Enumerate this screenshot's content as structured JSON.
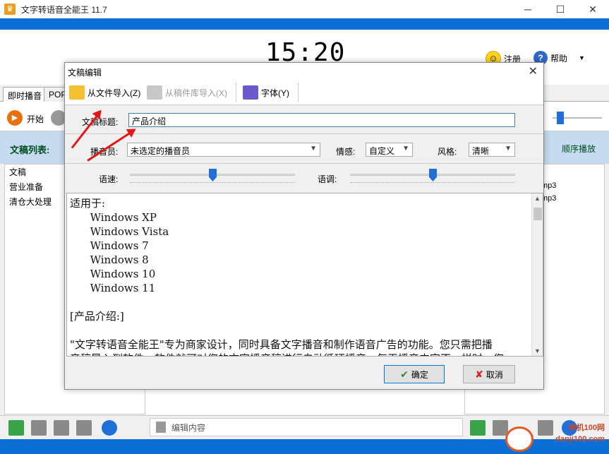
{
  "app": {
    "title": "文字转语音全能王 11.7",
    "clock": "15:20",
    "register": "注册",
    "help": "帮助"
  },
  "tabs": [
    "即时播音",
    "POP"
  ],
  "controls": {
    "start": "开始"
  },
  "list": {
    "title": "文稿列表:",
    "sequence": "顺序播放",
    "items": [
      "文稿",
      "营业准备",
      "清仓大处理"
    ],
    "right_items": [
      "mp3",
      "mp3"
    ]
  },
  "bottom": {
    "edit_placeholder": "编辑内容"
  },
  "watermark": {
    "line1": "单机100网",
    "line2": "danji100.com"
  },
  "dialog": {
    "title": "文稿编辑",
    "import_file": "从文件导入(Z)",
    "import_lib": "从稿件库导入(X)",
    "font": "字体(Y)",
    "title_label": "文稿标题:",
    "title_value": "产品介绍",
    "announcer_label": "播音员:",
    "announcer_value": "未选定的播音员",
    "emotion_label": "情感:",
    "emotion_value": "自定义",
    "style_label": "风格:",
    "style_value": "清晰",
    "speed_label": "语速:",
    "pitch_label": "语调:",
    "speed_value": 0.5,
    "pitch_value": 0.5,
    "content": "适用于:\n      Windows XP\n      Windows Vista\n      Windows 7\n      Windows 8\n      Windows 10\n      Windows 11\n\n[产品介绍:]\n\n\"文字转语音全能王\"专为商家设计，同时具备文字播音和制作语音广告的功能。您只需把播\n音稿导入到软件，软件就可对您的文字播音稿进行自动循环播音。每天播音内容不一样时，您",
    "ok": "确定",
    "cancel": "取消"
  },
  "colors": {
    "accent": "#0b6fd6",
    "arrow": "#e01818"
  }
}
